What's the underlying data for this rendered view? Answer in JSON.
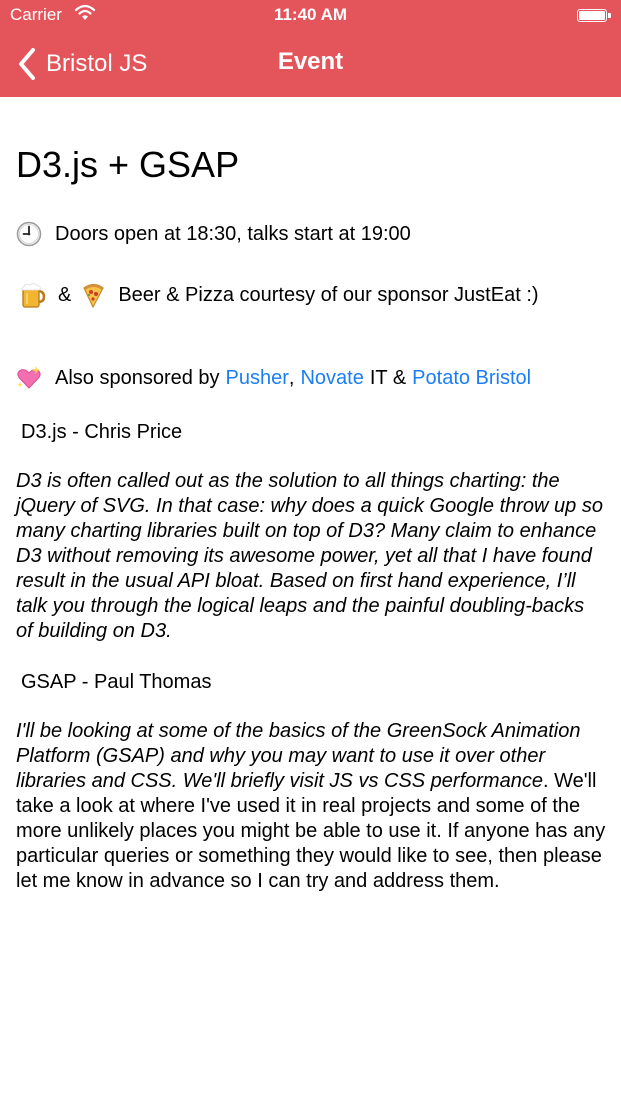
{
  "status_bar": {
    "carrier": "Carrier",
    "time": "11:40 AM"
  },
  "nav": {
    "back_label": "Bristol JS",
    "title": "Event",
    "color": "#e3555a"
  },
  "event": {
    "title": "D3.js + GSAP",
    "doors_text": "Doors open at 18:30, talks start at 19:00",
    "food_amp": "&",
    "food_text": "Beer & Pizza courtesy of our sponsor JustEat :)",
    "sponsors_prefix": "Also sponsored by",
    "sponsor_pusher": "Pusher",
    "sponsor_sep": ",",
    "sponsor_novate": "Novate",
    "sponsor_it": "IT &",
    "sponsor_potato": "Potato Bristol",
    "link_color": "#1b7ef6",
    "icons": [
      "clock-icon",
      "beer-icon",
      "pizza-icon",
      "sparkling-heart-icon"
    ]
  },
  "talks": [
    {
      "heading": "D3.js - Chris Price",
      "abstract": "D3 is often called out as the solution to all things charting: the jQuery of SVG. In that case: why does a quick Google throw up so many charting libraries built on top of D3? Many claim to enhance D3 without removing its awesome power, yet all that I have found result in the usual API bloat. Based on first hand experience, I’ll talk you through the logical leaps and the painful doubling-backs of building on D3."
    },
    {
      "heading": "GSAP - Paul Thomas",
      "abstract_italic": "I'll be looking at some of the basics of the GreenSock Animation Platform (GSAP) and why you may want to use it over other libraries and CSS. We'll briefly visit JS vs CSS performance",
      "abstract_rest": ". We'll take a look at where I've used it in real projects and some of the more unlikely places you might be able to use it. If anyone has any particular queries or something they would like to see, then please let me know in advance so I can try and address them."
    }
  ]
}
